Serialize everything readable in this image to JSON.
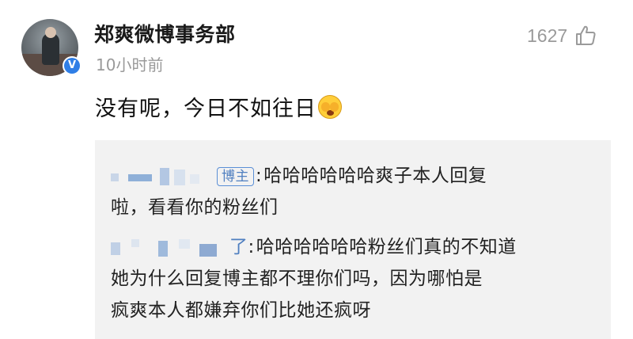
{
  "post": {
    "author": "郑爽微博事务部",
    "time": "10小时前",
    "like_count": "1627",
    "text": "没有呢，今日不如往日",
    "emoji": "face-with-hand-over-mouth-icon",
    "verified_badge": "V"
  },
  "replies": [
    {
      "badge": "博主",
      "separator": ":",
      "line1": "哈哈哈哈哈哈爽子本人回复",
      "line2": "啦，看看你的粉丝们"
    },
    {
      "name_tail": "了",
      "separator": ":",
      "line1": "哈哈哈哈哈哈粉丝们真的不知道",
      "line2": "她为什么回复博主都不理你们吗，因为哪怕是",
      "line3": "疯爽本人都嫌弃你们比她还疯呀"
    }
  ],
  "colors": {
    "verified_blue": "#2f7ee6",
    "reply_background": "#f2f2f2",
    "secondary_text": "#9a9a9a"
  }
}
